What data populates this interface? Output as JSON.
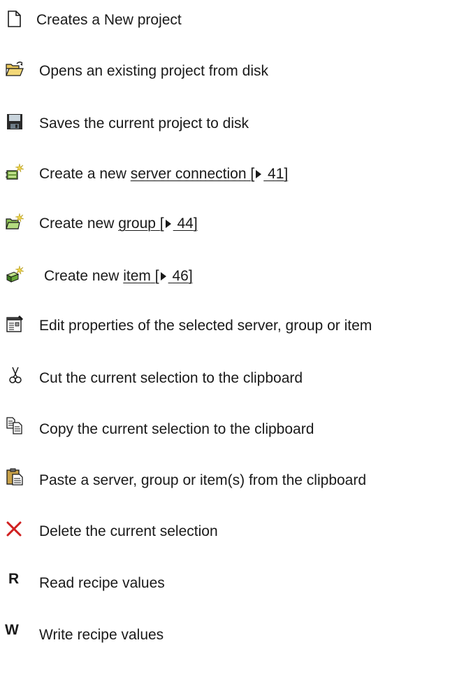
{
  "items": [
    {
      "icon": "new-project-icon",
      "text": "Creates a New project"
    },
    {
      "icon": "open-folder-icon",
      "text": "Opens an existing project from disk"
    },
    {
      "icon": "save-disk-icon",
      "text": "Saves the current project to disk"
    },
    {
      "icon": "new-server-connection-icon",
      "prefix": "Create a new ",
      "link": "server connection",
      "ref_open": "[",
      "ref_page": "41",
      "ref_close": "]"
    },
    {
      "icon": "new-group-icon",
      "prefix": "Create new ",
      "link": "group",
      "ref_open": "[",
      "ref_page": "44",
      "ref_close": "]"
    },
    {
      "icon": "new-item-icon",
      "prefix": "Create new ",
      "link": "item",
      "ref_open": "[",
      "ref_page": "46",
      "ref_close": "]"
    },
    {
      "icon": "properties-icon",
      "text": "Edit properties of the selected server, group or item"
    },
    {
      "icon": "scissors-icon",
      "text": "Cut the current selection to the clipboard"
    },
    {
      "icon": "copy-icon",
      "text": "Copy the current selection to the clipboard"
    },
    {
      "icon": "paste-icon",
      "text": "Paste a server, group or item(s) from the clipboard"
    },
    {
      "icon": "delete-x-icon",
      "text": "Delete the current selection"
    },
    {
      "icon": "read-r-icon",
      "glyph": "R",
      "text": "Read recipe values"
    },
    {
      "icon": "write-w-icon",
      "glyph": "W",
      "text": "Write recipe values"
    }
  ]
}
